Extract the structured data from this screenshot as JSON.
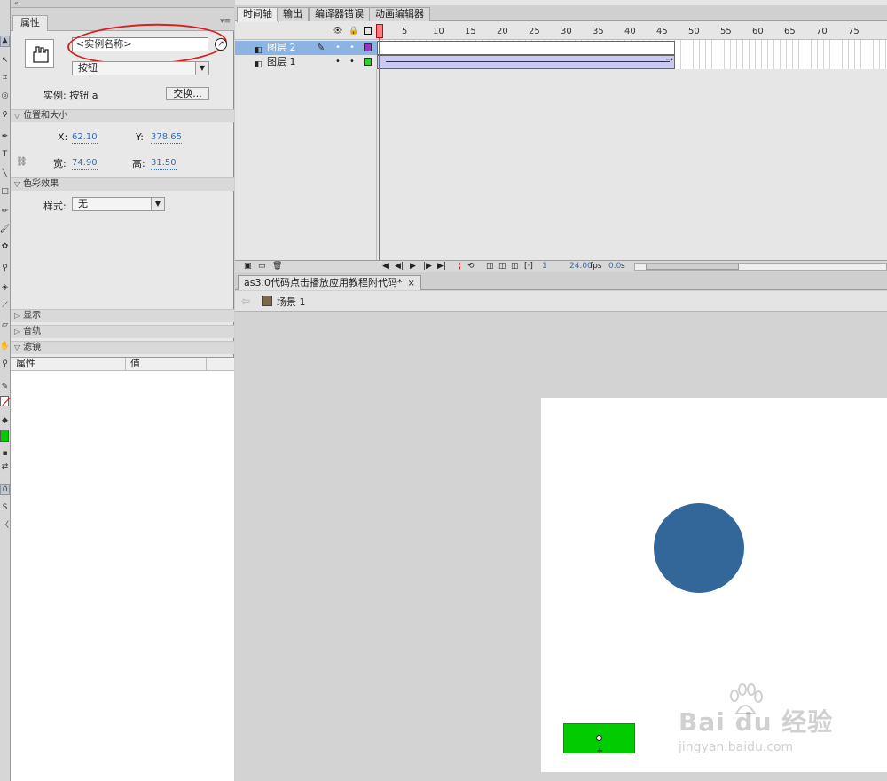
{
  "properties_panel": {
    "collapse_glyph": "«",
    "tab_label": "属性",
    "instance_name_placeholder": "<实例名称>",
    "type_select": "按钮",
    "instance_of": "实例: 按钮 a",
    "swap_button": "交换...",
    "sections": {
      "position_size": "位置和大小",
      "color_effect": "色彩效果",
      "display": "显示",
      "tracks": "音轨",
      "filters": "滤镜"
    },
    "x_label": "X:",
    "x_value": "62.10",
    "y_label": "Y:",
    "y_value": "378.65",
    "width_label": "宽:",
    "width_value": "74.90",
    "height_label": "高:",
    "height_value": "31.50",
    "style_label": "样式:",
    "style_value": "无",
    "filter_columns": [
      "属性",
      "值"
    ]
  },
  "timeline": {
    "tabs": [
      "时间轴",
      "输出",
      "编译器错误",
      "动画编辑器"
    ],
    "ruler_numbers": [
      "1",
      "5",
      "10",
      "15",
      "20",
      "25",
      "30",
      "35",
      "40",
      "45",
      "50",
      "55",
      "60",
      "65",
      "70",
      "75"
    ],
    "layers": [
      {
        "name": "图层 2",
        "selected": true,
        "color": "#9933cc"
      },
      {
        "name": "图层 1",
        "selected": false,
        "color": "#33cc33"
      }
    ],
    "footer": {
      "current_frame": "1",
      "fps": "24.00",
      "fps_unit": "fps",
      "time": "0.0",
      "time_unit": "s"
    }
  },
  "document": {
    "tab_title": "as3.0代码点击播放应用教程附代码*",
    "tab_close": "×",
    "scene_label": "场景 1"
  },
  "stage": {
    "circle_color": "#336699",
    "button_color": "#00cc00"
  },
  "watermark": {
    "main": "Bai du 经验",
    "sub": "jingyan.baidu.com"
  },
  "colors": {
    "accent_selection": "#8bb4e3",
    "annotation_ring": "#d82020",
    "value_link": "#3a6fb0"
  }
}
